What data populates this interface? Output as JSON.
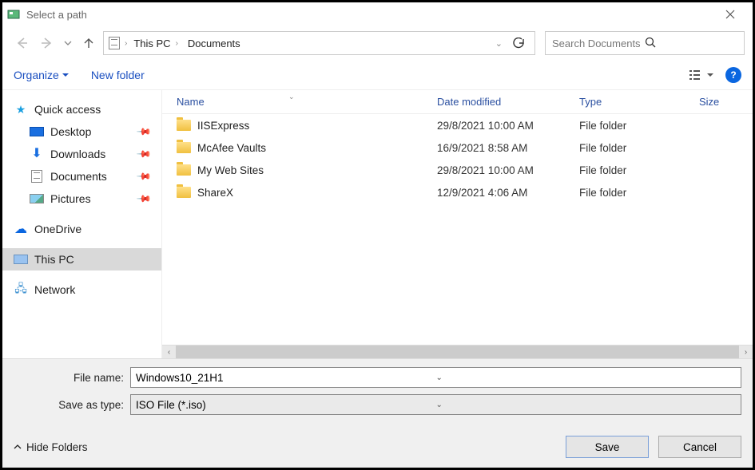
{
  "titlebar": {
    "title": "Select a path"
  },
  "breadcrumbs": {
    "root_icon": "pc",
    "item1": "This PC",
    "item2": "Documents"
  },
  "search": {
    "placeholder": "Search Documents"
  },
  "toolbar": {
    "organize": "Organize",
    "new_folder": "New folder"
  },
  "sidebar": {
    "quick_access": "Quick access",
    "desktop": "Desktop",
    "downloads": "Downloads",
    "documents": "Documents",
    "pictures": "Pictures",
    "onedrive": "OneDrive",
    "this_pc": "This PC",
    "network": "Network"
  },
  "columns": {
    "name": "Name",
    "date": "Date modified",
    "type": "Type",
    "size": "Size"
  },
  "rows": [
    {
      "name": "IISExpress",
      "date": "29/8/2021 10:00 AM",
      "type": "File folder",
      "size": ""
    },
    {
      "name": "McAfee Vaults",
      "date": "16/9/2021 8:58 AM",
      "type": "File folder",
      "size": ""
    },
    {
      "name": "My Web Sites",
      "date": "29/8/2021 10:00 AM",
      "type": "File folder",
      "size": ""
    },
    {
      "name": "ShareX",
      "date": "12/9/2021 4:06 AM",
      "type": "File folder",
      "size": ""
    }
  ],
  "form": {
    "filename_label": "File name:",
    "filename_value": "Windows10_21H1",
    "saveas_label": "Save as type:",
    "saveas_value": "ISO File (*.iso)",
    "hide_folders": "Hide Folders",
    "save": "Save",
    "cancel": "Cancel"
  }
}
